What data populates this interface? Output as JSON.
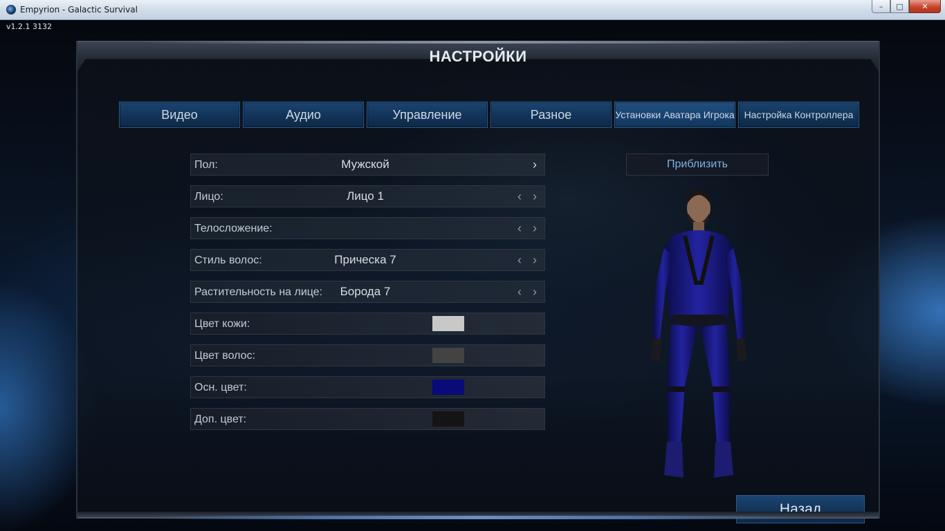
{
  "window": {
    "title": "Empyrion - Galactic Survival",
    "minimize_glyph": "–",
    "maximize_glyph": "□",
    "close_glyph": "✕"
  },
  "game": {
    "version": "v1.2.1 3132",
    "page_title": "НАСТРОЙКИ"
  },
  "tabs": [
    {
      "label": "Видео"
    },
    {
      "label": "Аудио"
    },
    {
      "label": "Управление"
    },
    {
      "label": "Разное"
    },
    {
      "label": "Установки Аватара Игрока"
    },
    {
      "label": "Настройка Контроллера"
    }
  ],
  "avatar_settings": {
    "gender": {
      "label": "Пол:",
      "value": "Мужской"
    },
    "face": {
      "label": "Лицо:",
      "value": "Лицо 1"
    },
    "body_type": {
      "label": "Телосложение:",
      "value": ""
    },
    "hair_style": {
      "label": "Стиль волос:",
      "value": "Прическа 7"
    },
    "facial_hair": {
      "label": "Растительность на лице:",
      "value": "Борода 7"
    },
    "skin_color": {
      "label": "Цвет кожи:",
      "color": "#c8c8c8"
    },
    "hair_color": {
      "label": "Цвет волос:",
      "color": "#434343"
    },
    "primary_color": {
      "label": "Осн. цвет:",
      "color": "#0a0a78"
    },
    "secondary_color": {
      "label": "Доп. цвет:",
      "color": "#141414"
    }
  },
  "icons": {
    "arrow_left": "‹",
    "arrow_right": "›"
  },
  "zoom_label": "Приблизить",
  "back_label": "Назад"
}
